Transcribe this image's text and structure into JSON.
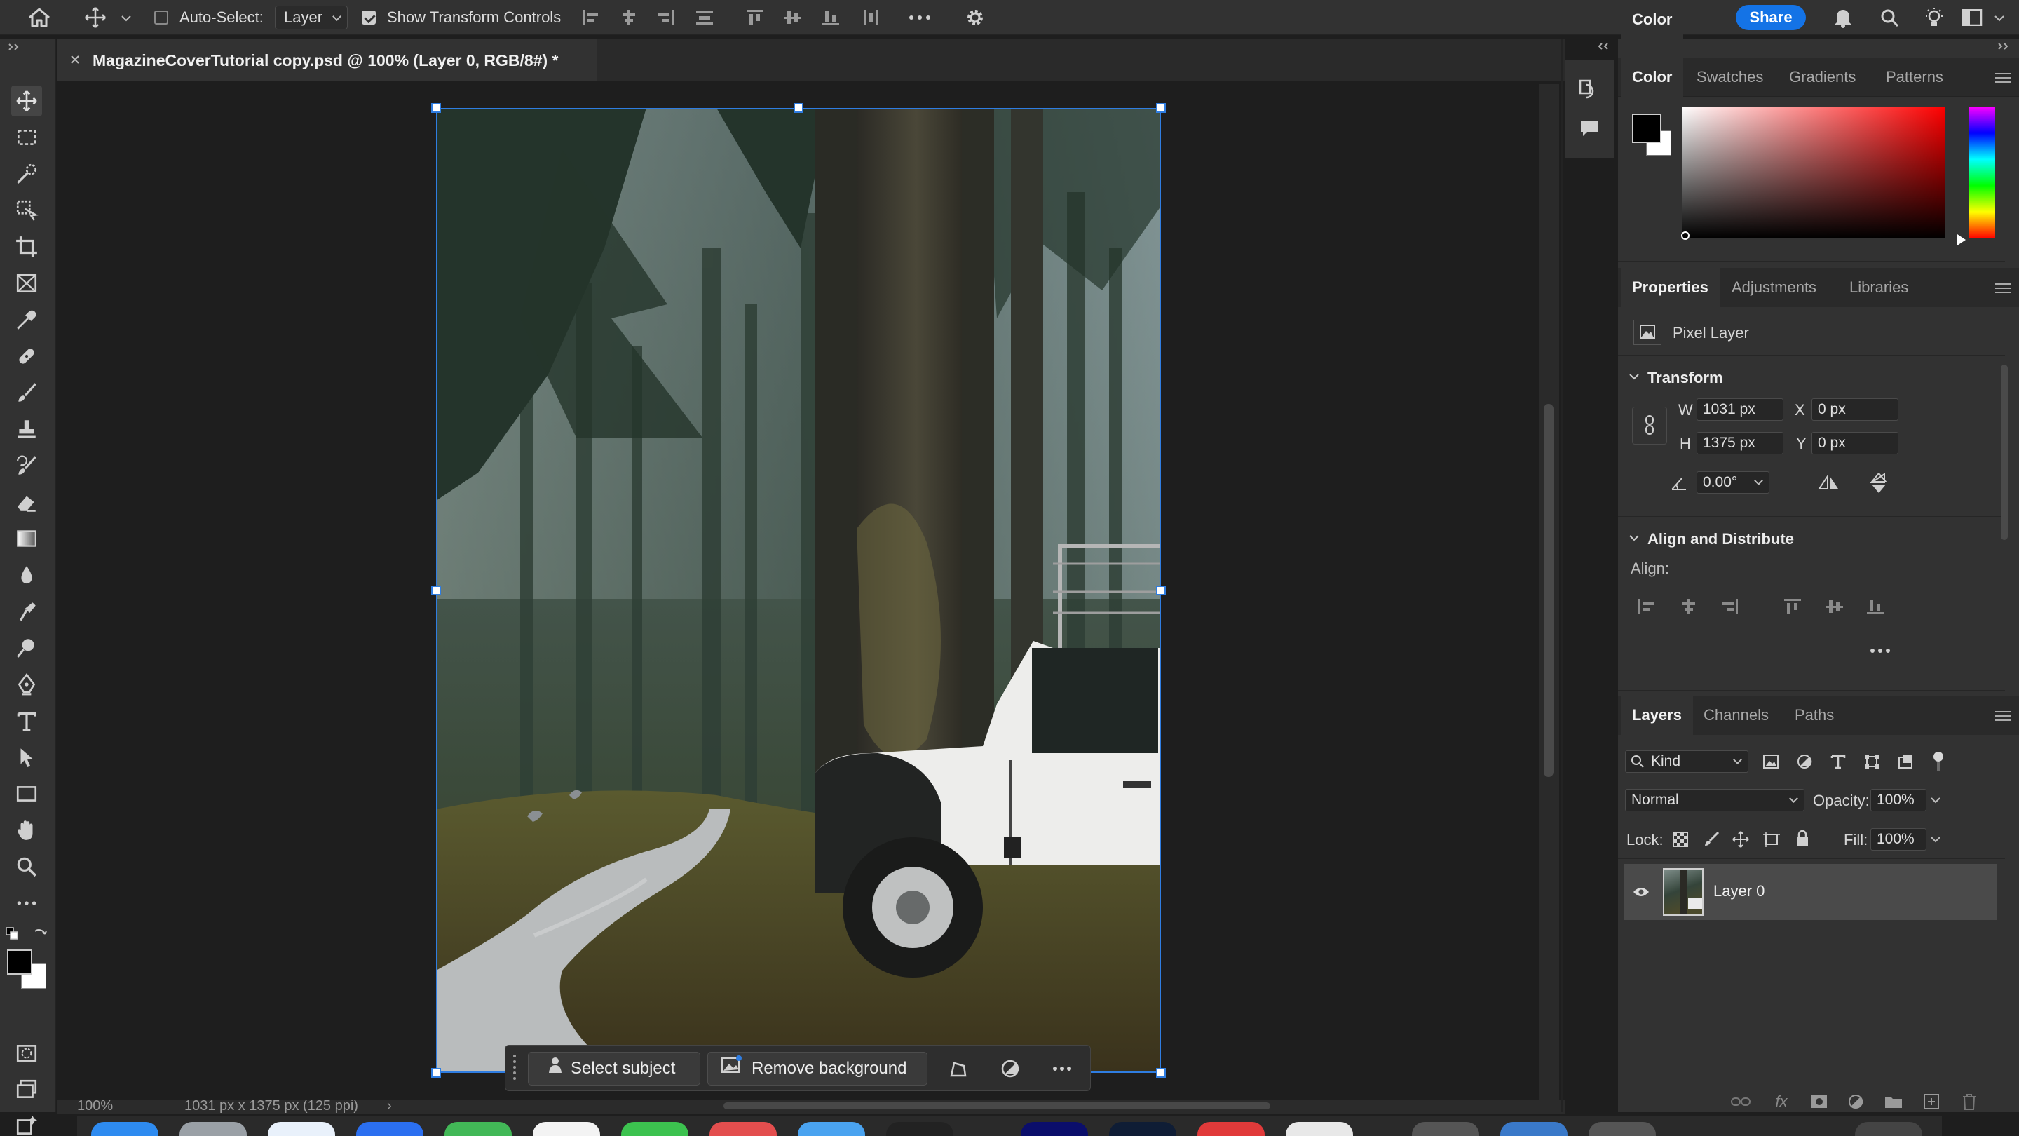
{
  "options_bar": {
    "auto_select_label": "Auto-Select:",
    "auto_select_checked": false,
    "layer_dropdown": "Layer",
    "show_transform_label": "Show Transform Controls",
    "show_transform_checked": true,
    "share_label": "Share"
  },
  "document": {
    "tab_title": "MagazineCoverTutorial copy.psd @ 100% (Layer 0, RGB/8#) *"
  },
  "contextual_bar": {
    "select_subject": "Select subject",
    "remove_background": "Remove background"
  },
  "status": {
    "zoom": "100%",
    "doc_info": "1031 px x 1375 px (125 ppi)"
  },
  "color_panel": {
    "tabs": [
      "Color",
      "Swatches",
      "Gradients",
      "Patterns"
    ],
    "active_tab": "Color",
    "foreground": "#000000",
    "background": "#ffffff",
    "hue": "#ff0000"
  },
  "properties_panel": {
    "tabs": [
      "Properties",
      "Adjustments",
      "Libraries"
    ],
    "layer_type": "Pixel Layer",
    "transform_heading": "Transform",
    "w_label": "W",
    "w_value": "1031 px",
    "h_label": "H",
    "h_value": "1375 px",
    "x_label": "X",
    "x_value": "0 px",
    "y_label": "Y",
    "y_value": "0 px",
    "angle_value": "0.00°",
    "align_heading": "Align and Distribute",
    "align_label": "Align:"
  },
  "layers_panel": {
    "tabs": [
      "Layers",
      "Channels",
      "Paths"
    ],
    "filter_kind": "Kind",
    "blend_mode": "Normal",
    "opacity_label": "Opacity:",
    "opacity_value": "100%",
    "lock_label": "Lock:",
    "fill_label": "Fill:",
    "fill_value": "100%",
    "layers": [
      {
        "name": "Layer 0",
        "visible": true,
        "selected": true
      }
    ]
  },
  "colors": {
    "accent": "#1473e6",
    "selection": "#2f7de1"
  }
}
